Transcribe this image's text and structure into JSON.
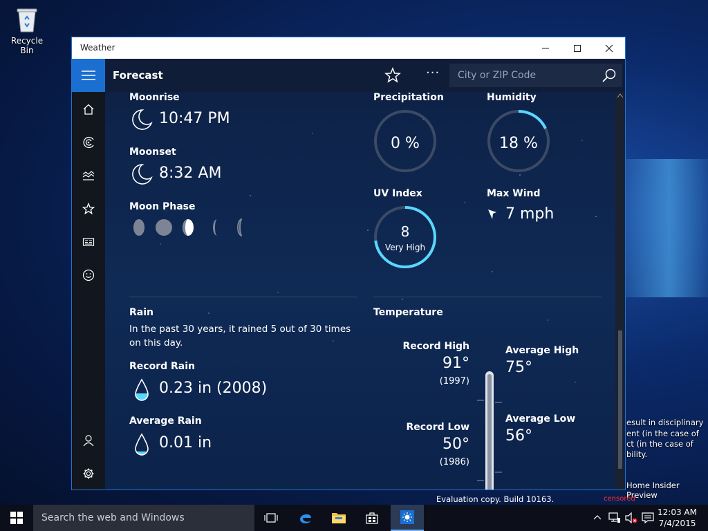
{
  "desktop": {
    "recycle_bin_label": "Recycle Bin",
    "side_text_lines": [
      "esult in disciplinary",
      "ent (in the case of",
      "ct (in the case of",
      "bility."
    ],
    "home_insider": "Home Insider Preview",
    "evaluation": "Evaluation copy. Build 10163.",
    "censored": "censored"
  },
  "window": {
    "title": "Weather",
    "controls": {
      "minimize": "—",
      "maximize": "☐",
      "close": "✕"
    }
  },
  "appbar": {
    "title": "Forecast",
    "more_label": "···",
    "search_placeholder": "City or ZIP Code"
  },
  "nav": {
    "items": [
      "home-icon",
      "forecast-radar-icon",
      "historical-chart-icon",
      "favorites-star-icon",
      "news-icon",
      "smiley-feedback-icon"
    ],
    "bottom": [
      "account-icon",
      "settings-icon"
    ]
  },
  "moon": {
    "moonrise_label": "Moonrise",
    "moonrise_value": "10:47 PM",
    "moonset_label": "Moonset",
    "moonset_value": "8:32 AM",
    "phase_label": "Moon Phase"
  },
  "stats": {
    "precip_label": "Precipitation",
    "precip_value": "0 %",
    "precip_fraction": 0,
    "humidity_label": "Humidity",
    "humidity_value": "18 %",
    "humidity_fraction": 0.18,
    "uv_label": "UV Index",
    "uv_value": "8",
    "uv_desc": "Very High",
    "uv_fraction": 0.73,
    "wind_label": "Max Wind",
    "wind_value": "7 mph"
  },
  "rain": {
    "label": "Rain",
    "description": "In the past 30 years, it rained 5 out of 30 times on this day.",
    "record_label": "Record Rain",
    "record_value": "0.23 in (2008)",
    "average_label": "Average Rain",
    "average_value": "0.01 in"
  },
  "temperature": {
    "label": "Temperature",
    "record_high_label": "Record High",
    "record_high_value": "91°",
    "record_high_year": "(1997)",
    "average_high_label": "Average High",
    "average_high_value": "75°",
    "record_low_label": "Record Low",
    "record_low_value": "50°",
    "record_low_year": "(1986)",
    "average_low_label": "Average Low",
    "average_low_value": "56°"
  },
  "taskbar": {
    "search_text": "Search the web and Windows",
    "time": "12:03 AM",
    "date": "7/4/2015",
    "accent": "#6fb0ff"
  }
}
